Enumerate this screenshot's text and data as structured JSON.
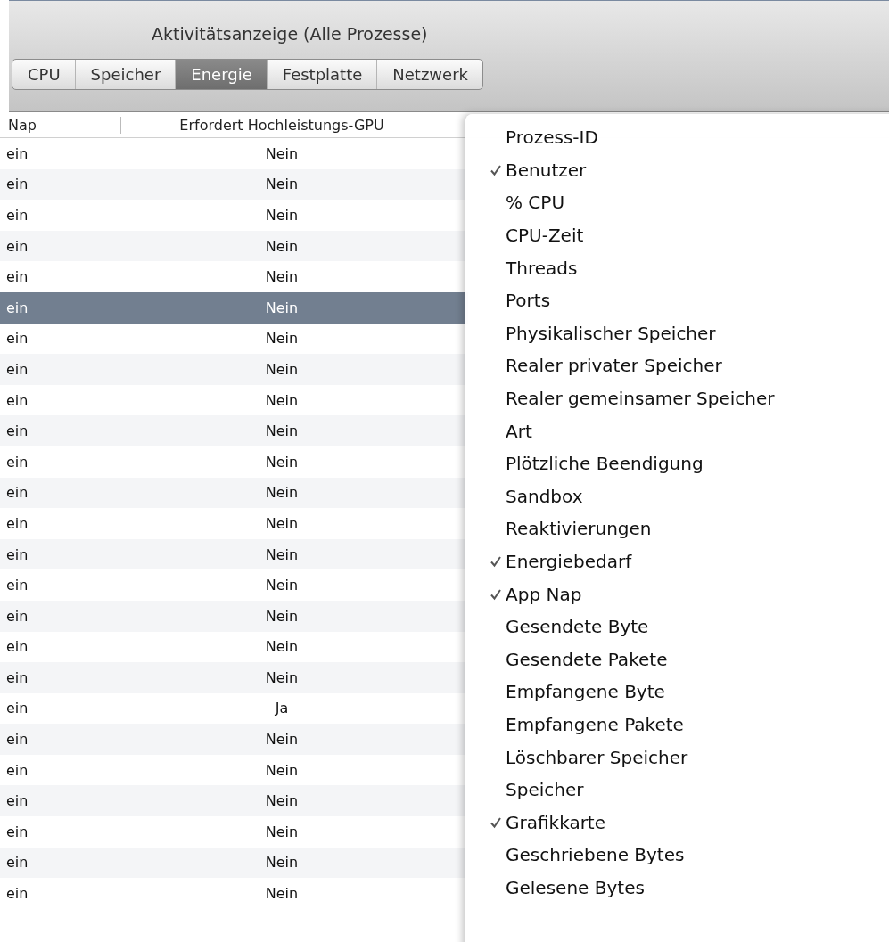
{
  "window": {
    "title": "Aktivitätsanzeige (Alle Prozesse)"
  },
  "tabs": [
    {
      "label": "CPU",
      "selected": false
    },
    {
      "label": "Speicher",
      "selected": false
    },
    {
      "label": "Energie",
      "selected": true
    },
    {
      "label": "Festplatte",
      "selected": false
    },
    {
      "label": "Netzwerk",
      "selected": false
    }
  ],
  "table": {
    "columns": [
      "Nap",
      "Erfordert Hochleistungs-GPU"
    ],
    "rows": [
      {
        "cells": [
          "ein",
          "Nein"
        ],
        "selected": false
      },
      {
        "cells": [
          "ein",
          "Nein"
        ],
        "selected": false
      },
      {
        "cells": [
          "ein",
          "Nein"
        ],
        "selected": false
      },
      {
        "cells": [
          "ein",
          "Nein"
        ],
        "selected": false
      },
      {
        "cells": [
          "ein",
          "Nein"
        ],
        "selected": false
      },
      {
        "cells": [
          "ein",
          "Nein"
        ],
        "selected": true
      },
      {
        "cells": [
          "ein",
          "Nein"
        ],
        "selected": false
      },
      {
        "cells": [
          "ein",
          "Nein"
        ],
        "selected": false
      },
      {
        "cells": [
          "ein",
          "Nein"
        ],
        "selected": false
      },
      {
        "cells": [
          "ein",
          "Nein"
        ],
        "selected": false
      },
      {
        "cells": [
          "ein",
          "Nein"
        ],
        "selected": false
      },
      {
        "cells": [
          "ein",
          "Nein"
        ],
        "selected": false
      },
      {
        "cells": [
          "ein",
          "Nein"
        ],
        "selected": false
      },
      {
        "cells": [
          "ein",
          "Nein"
        ],
        "selected": false
      },
      {
        "cells": [
          "ein",
          "Nein"
        ],
        "selected": false
      },
      {
        "cells": [
          "ein",
          "Nein"
        ],
        "selected": false
      },
      {
        "cells": [
          "ein",
          "Nein"
        ],
        "selected": false
      },
      {
        "cells": [
          "ein",
          "Nein"
        ],
        "selected": false
      },
      {
        "cells": [
          "ein",
          "Ja"
        ],
        "selected": false
      },
      {
        "cells": [
          "ein",
          "Nein"
        ],
        "selected": false
      },
      {
        "cells": [
          "ein",
          "Nein"
        ],
        "selected": false
      },
      {
        "cells": [
          "ein",
          "Nein"
        ],
        "selected": false
      },
      {
        "cells": [
          "ein",
          "Nein"
        ],
        "selected": false
      },
      {
        "cells": [
          "ein",
          "Nein"
        ],
        "selected": false
      },
      {
        "cells": [
          "ein",
          "Nein"
        ],
        "selected": false
      }
    ]
  },
  "menu": {
    "items": [
      {
        "label": "Prozess-ID",
        "checked": false
      },
      {
        "label": "Benutzer",
        "checked": true
      },
      {
        "label": "% CPU",
        "checked": false
      },
      {
        "label": "CPU-Zeit",
        "checked": false
      },
      {
        "label": "Threads",
        "checked": false
      },
      {
        "label": "Ports",
        "checked": false
      },
      {
        "label": "Physikalischer Speicher",
        "checked": false
      },
      {
        "label": "Realer privater Speicher",
        "checked": false
      },
      {
        "label": "Realer gemeinsamer Speicher",
        "checked": false
      },
      {
        "label": "Art",
        "checked": false
      },
      {
        "label": "Plötzliche Beendigung",
        "checked": false
      },
      {
        "label": "Sandbox",
        "checked": false
      },
      {
        "label": "Reaktivierungen",
        "checked": false
      },
      {
        "label": "Energiebedarf",
        "checked": true
      },
      {
        "label": "App Nap",
        "checked": true
      },
      {
        "label": "Gesendete Byte",
        "checked": false
      },
      {
        "label": "Gesendete Pakete",
        "checked": false
      },
      {
        "label": "Empfangene Byte",
        "checked": false
      },
      {
        "label": "Empfangene Pakete",
        "checked": false
      },
      {
        "label": "Löschbarer Speicher",
        "checked": false
      },
      {
        "label": "Speicher",
        "checked": false
      },
      {
        "label": "Grafikkarte",
        "checked": true
      },
      {
        "label": "Geschriebene Bytes",
        "checked": false
      },
      {
        "label": "Gelesene Bytes",
        "checked": false
      }
    ]
  }
}
